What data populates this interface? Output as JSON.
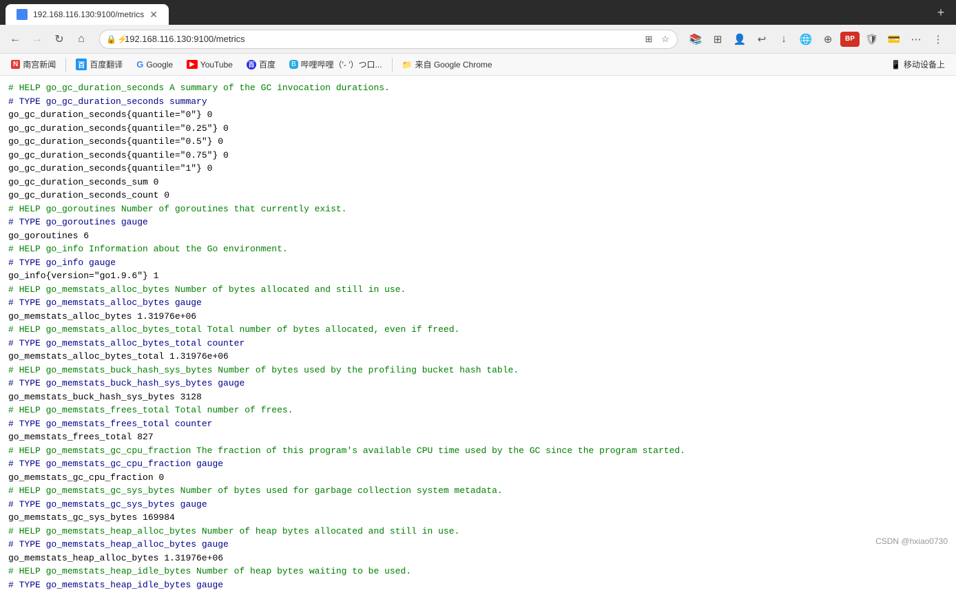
{
  "browser": {
    "tab": {
      "title": "192.168.116.130:9100/metrics",
      "favicon_color": "#4285f4"
    },
    "nav": {
      "back_disabled": false,
      "forward_disabled": true,
      "url": "192.168.116.130:9100/metrics",
      "url_full": "192.168.116.130:9100/metrics"
    },
    "bookmarks": [
      {
        "label": "南宫新闻",
        "icon": "N",
        "icon_bg": "#e53935"
      },
      {
        "label": "百度翻译",
        "icon": "百",
        "icon_bg": "#2196f3"
      },
      {
        "label": "Google",
        "icon": "G",
        "icon_bg": "#4285f4"
      },
      {
        "label": "YouTube",
        "icon": "▶",
        "icon_bg": "#ff0000"
      },
      {
        "label": "百度",
        "icon": "百",
        "icon_bg": "#2932e1"
      },
      {
        "label": "哔哩哔哩（'- '）つ口...",
        "icon": "B",
        "icon_bg": "#23ADE5"
      },
      {
        "label": "来自 Google Chrome",
        "icon": "📁",
        "icon_bg": "#888"
      }
    ],
    "right_bookmarks": [
      {
        "label": "移动设备上",
        "icon": "📱"
      }
    ]
  },
  "page": {
    "lines": [
      {
        "type": "comment",
        "text": "# HELP go_gc_duration_seconds A summary of the GC invocation durations."
      },
      {
        "type": "type",
        "text": "# TYPE go_gc_duration_seconds summary"
      },
      {
        "type": "metric",
        "text": "go_gc_duration_seconds{quantile=\"0\"} 0"
      },
      {
        "type": "metric",
        "text": "go_gc_duration_seconds{quantile=\"0.25\"} 0"
      },
      {
        "type": "metric",
        "text": "go_gc_duration_seconds{quantile=\"0.5\"} 0"
      },
      {
        "type": "metric",
        "text": "go_gc_duration_seconds{quantile=\"0.75\"} 0"
      },
      {
        "type": "metric",
        "text": "go_gc_duration_seconds{quantile=\"1\"} 0"
      },
      {
        "type": "metric",
        "text": "go_gc_duration_seconds_sum 0"
      },
      {
        "type": "metric",
        "text": "go_gc_duration_seconds_count 0"
      },
      {
        "type": "comment",
        "text": "# HELP go_goroutines Number of goroutines that currently exist."
      },
      {
        "type": "type",
        "text": "# TYPE go_goroutines gauge"
      },
      {
        "type": "metric",
        "text": "go_goroutines 6"
      },
      {
        "type": "comment",
        "text": "# HELP go_info Information about the Go environment."
      },
      {
        "type": "type",
        "text": "# TYPE go_info gauge"
      },
      {
        "type": "metric",
        "text": "go_info{version=\"go1.9.6\"} 1"
      },
      {
        "type": "comment",
        "text": "# HELP go_memstats_alloc_bytes Number of bytes allocated and still in use."
      },
      {
        "type": "type",
        "text": "# TYPE go_memstats_alloc_bytes gauge"
      },
      {
        "type": "metric",
        "text": "go_memstats_alloc_bytes 1.31976e+06"
      },
      {
        "type": "comment",
        "text": "# HELP go_memstats_alloc_bytes_total Total number of bytes allocated, even if freed."
      },
      {
        "type": "type",
        "text": "# TYPE go_memstats_alloc_bytes_total counter"
      },
      {
        "type": "metric",
        "text": "go_memstats_alloc_bytes_total 1.31976e+06"
      },
      {
        "type": "comment",
        "text": "# HELP go_memstats_buck_hash_sys_bytes Number of bytes used by the profiling bucket hash table."
      },
      {
        "type": "type",
        "text": "# TYPE go_memstats_buck_hash_sys_bytes gauge"
      },
      {
        "type": "metric",
        "text": "go_memstats_buck_hash_sys_bytes 3128"
      },
      {
        "type": "comment",
        "text": "# HELP go_memstats_frees_total Total number of frees."
      },
      {
        "type": "type",
        "text": "# TYPE go_memstats_frees_total counter"
      },
      {
        "type": "metric",
        "text": "go_memstats_frees_total 827"
      },
      {
        "type": "comment",
        "text": "# HELP go_memstats_gc_cpu_fraction The fraction of this program's available CPU time used by the GC since the program started."
      },
      {
        "type": "type",
        "text": "# TYPE go_memstats_gc_cpu_fraction gauge"
      },
      {
        "type": "metric",
        "text": "go_memstats_gc_cpu_fraction 0"
      },
      {
        "type": "comment",
        "text": "# HELP go_memstats_gc_sys_bytes Number of bytes used for garbage collection system metadata."
      },
      {
        "type": "type",
        "text": "# TYPE go_memstats_gc_sys_bytes gauge"
      },
      {
        "type": "metric",
        "text": "go_memstats_gc_sys_bytes 169984"
      },
      {
        "type": "comment",
        "text": "# HELP go_memstats_heap_alloc_bytes Number of heap bytes allocated and still in use."
      },
      {
        "type": "type",
        "text": "# TYPE go_memstats_heap_alloc_bytes gauge"
      },
      {
        "type": "metric",
        "text": "go_memstats_heap_alloc_bytes 1.31976e+06"
      },
      {
        "type": "comment",
        "text": "# HELP go_memstats_heap_idle_bytes Number of heap bytes waiting to be used."
      },
      {
        "type": "type",
        "text": "# TYPE go_memstats_heap_idle_bytes gauge"
      }
    ],
    "watermark": "CSDN @hxiao0730"
  }
}
